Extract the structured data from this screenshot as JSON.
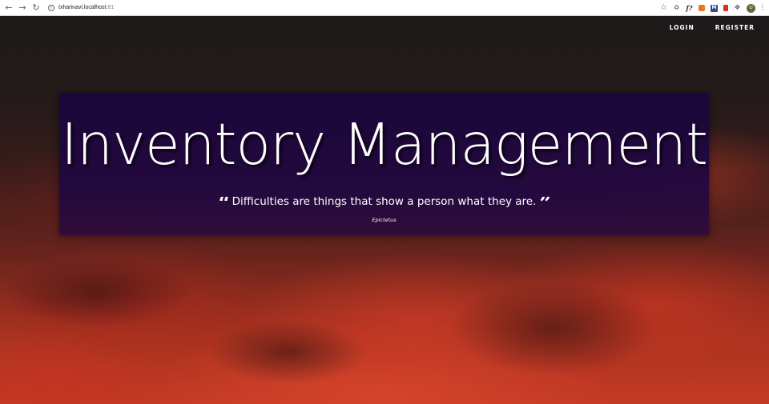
{
  "browser": {
    "url_host": "txharinavi.localhost",
    "url_port": ":81",
    "icons": [
      "back-icon",
      "forward-icon",
      "reload-icon",
      "info-icon",
      "star-icon",
      "recycle-icon",
      "fx-icon",
      "fox-icon",
      "m-icon",
      "lock-icon",
      "puzzle-icon",
      "avatar",
      "menu-icon"
    ],
    "avatar_initial": "U"
  },
  "nav": {
    "login_label": "LOGIN",
    "register_label": "REGISTER"
  },
  "hero": {
    "title": "Inventory Management",
    "quote": "Difficulties are things that show a person what they are.",
    "author": "Epictetus"
  },
  "colors": {
    "hero_bg": "#1a063a",
    "text": "#ffffff",
    "sky_dark": "#1c1918",
    "cloud_red": "#c43a24"
  }
}
